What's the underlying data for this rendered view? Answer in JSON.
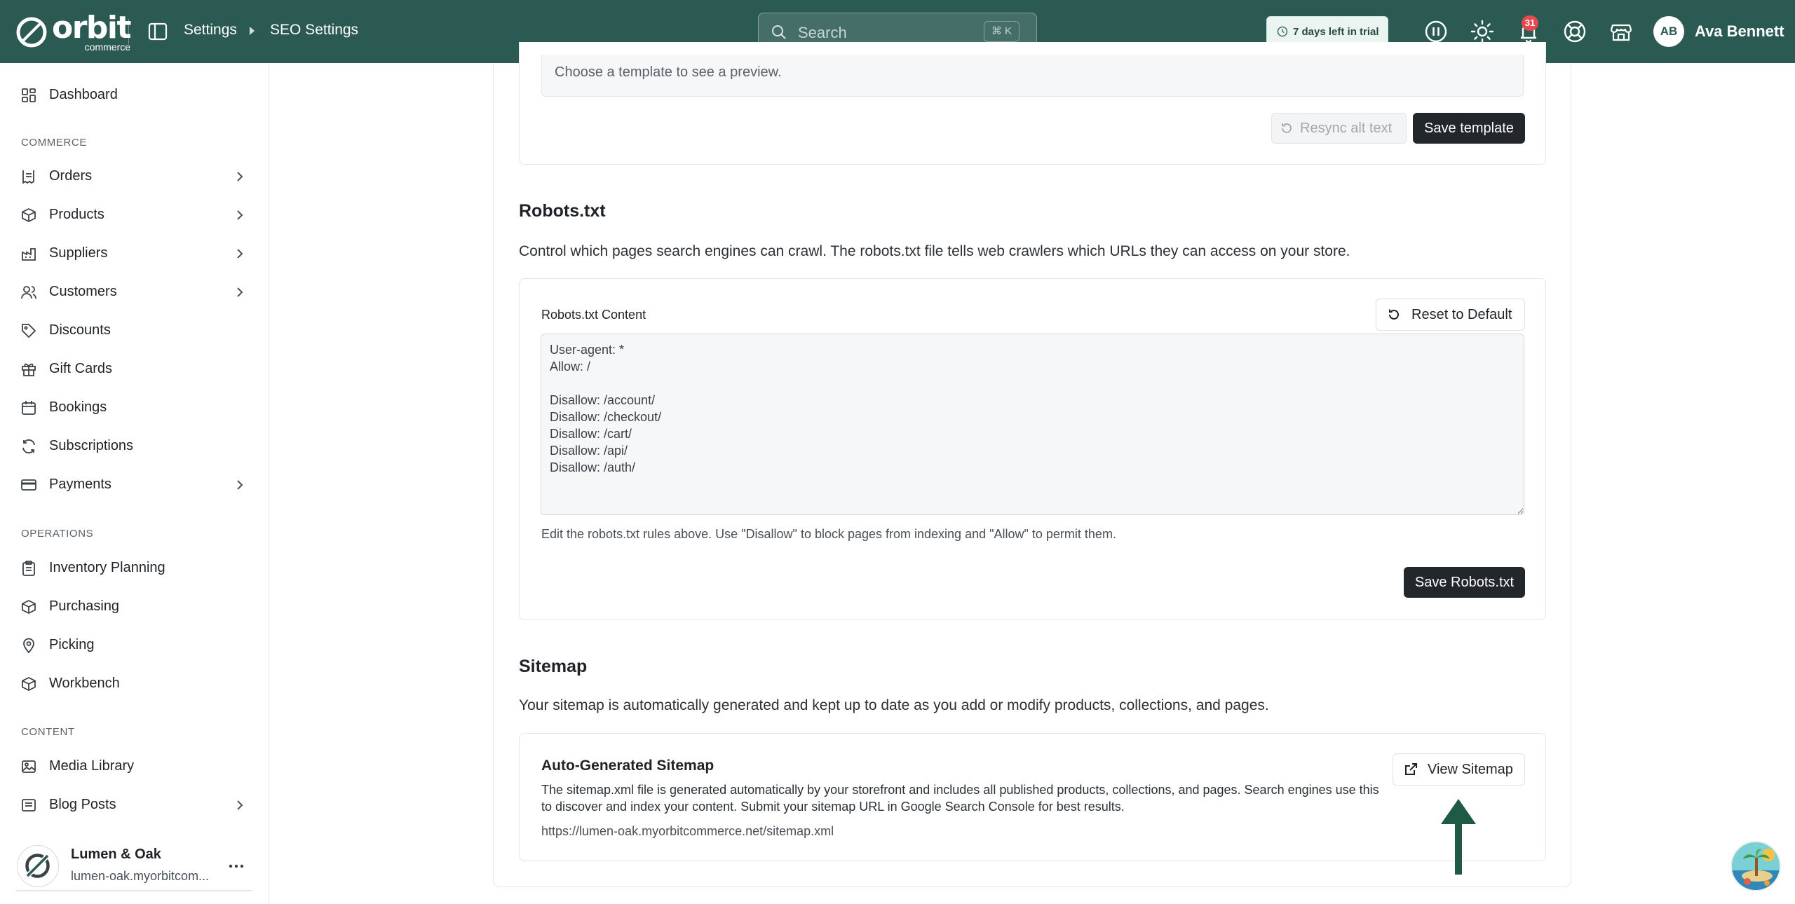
{
  "topbar": {
    "brand": "orbit",
    "brand_sub": "commerce",
    "breadcrumb": [
      "Settings",
      "SEO Settings"
    ],
    "search_placeholder": "Search",
    "search_shortcut": "⌘ K",
    "trial_label": "7 days left in trial",
    "notification_count": "31",
    "user_initials": "AB",
    "user_name": "Ava Bennett"
  },
  "sidebar": {
    "dashboard": "Dashboard",
    "section_commerce": "COMMERCE",
    "orders": "Orders",
    "products": "Products",
    "suppliers": "Suppliers",
    "customers": "Customers",
    "discounts": "Discounts",
    "gift_cards": "Gift Cards",
    "bookings": "Bookings",
    "subscriptions": "Subscriptions",
    "payments": "Payments",
    "section_operations": "OPERATIONS",
    "inventory_planning": "Inventory Planning",
    "purchasing": "Purchasing",
    "picking": "Picking",
    "workbench": "Workbench",
    "section_content": "CONTENT",
    "media_library": "Media Library",
    "blog_posts": "Blog Posts",
    "store_name": "Lumen & Oak",
    "store_url": "lumen-oak.myorbitcom..."
  },
  "template_card": {
    "preview_placeholder": "Choose a template to see a preview.",
    "resync_label": "Resync alt text",
    "save_label": "Save template"
  },
  "robots": {
    "title": "Robots.txt",
    "description": "Control which pages search engines can crawl. The robots.txt file tells web crawlers which URLs they can access on your store.",
    "field_label": "Robots.txt Content",
    "reset_label": "Reset to Default",
    "content": "User-agent: *\nAllow: /\n\nDisallow: /account/\nDisallow: /checkout/\nDisallow: /cart/\nDisallow: /api/\nDisallow: /auth/",
    "helper": "Edit the robots.txt rules above. Use \"Disallow\" to block pages from indexing and \"Allow\" to permit them.",
    "save_label": "Save Robots.txt"
  },
  "sitemap": {
    "title": "Sitemap",
    "description": "Your sitemap is automatically generated and kept up to date as you add or modify products, collections, and pages.",
    "card_title": "Auto-Generated Sitemap",
    "card_desc": "The sitemap.xml file is generated automatically by your storefront and includes all published products, collections, and pages. Search engines use this to discover and index your content. Submit your sitemap URL in Google Search Console for best results.",
    "url": "https://lumen-oak.myorbitcommerce.net/sitemap.xml",
    "view_label": "View Sitemap"
  },
  "colors": {
    "topbar": "#2b5a52",
    "primary_button": "#23272b",
    "arrow": "#1f5a45",
    "badge": "#e5484d"
  }
}
